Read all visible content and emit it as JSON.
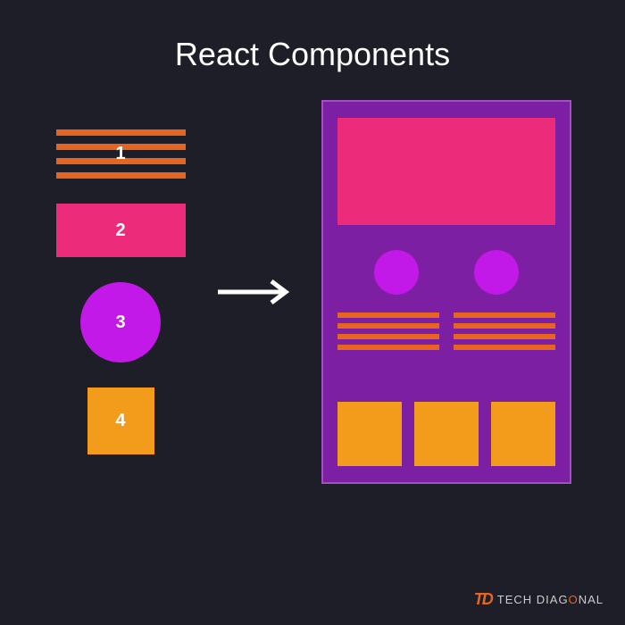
{
  "title": "React Components",
  "components": {
    "items": [
      {
        "num": "1"
      },
      {
        "num": "2"
      },
      {
        "num": "3"
      },
      {
        "num": "4"
      }
    ]
  },
  "logo": {
    "mark": "TD",
    "text_pre": "TECH DIAG",
    "text_o": "O",
    "text_post": "NAL"
  },
  "colors": {
    "bg": "#1e1e28",
    "orange_line": "#e8651f",
    "pink": "#ec2b7a",
    "magenta": "#c218e8",
    "orange_box": "#f39b1a",
    "purple_panel": "#7c1fa2"
  }
}
